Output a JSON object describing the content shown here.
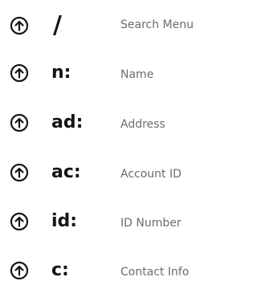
{
  "shortcuts": [
    {
      "key": "/",
      "description": "Search Menu",
      "icon": "circle-arrow-up-icon"
    },
    {
      "key": "n:",
      "description": "Name",
      "icon": "circle-arrow-up-icon"
    },
    {
      "key": "ad:",
      "description": "Address",
      "icon": "circle-arrow-up-icon"
    },
    {
      "key": "ac:",
      "description": "Account ID",
      "icon": "circle-arrow-up-icon"
    },
    {
      "key": "id:",
      "description": "ID Number",
      "icon": "circle-arrow-up-icon"
    },
    {
      "key": "c:",
      "description": "Contact Info",
      "icon": "circle-arrow-up-icon"
    }
  ],
  "colors": {
    "key_text": "#161513",
    "description_text": "#6f6c69",
    "icon": "#161513"
  }
}
